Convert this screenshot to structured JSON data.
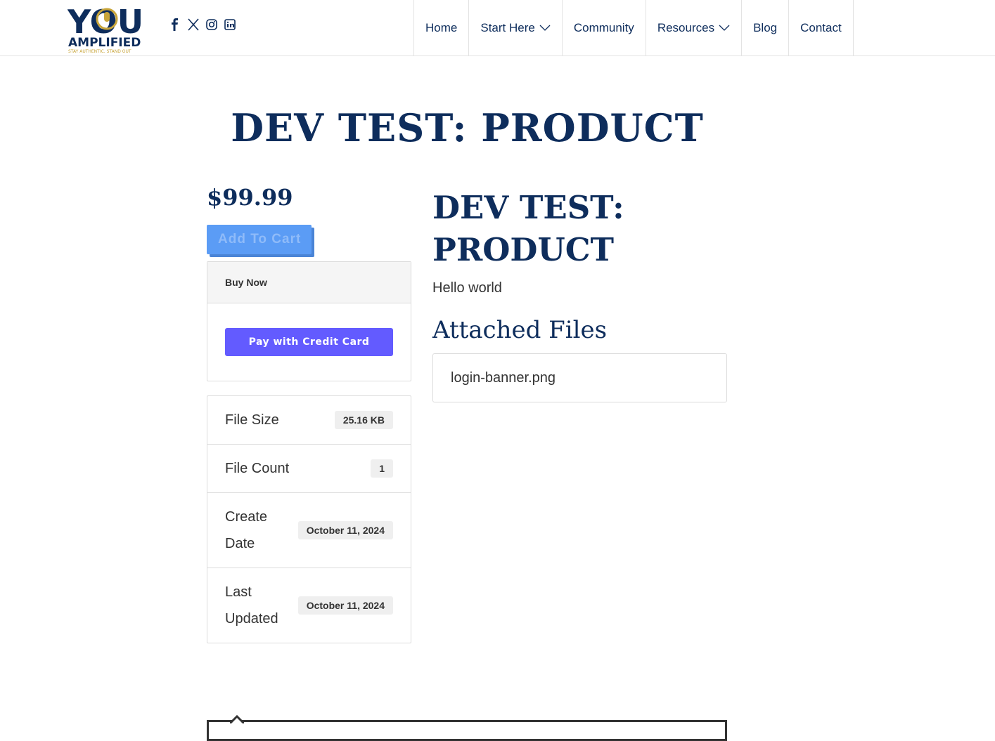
{
  "brand": {
    "logo_line1": "YOU",
    "logo_line2": "AMPLIFIED",
    "tagline": "STAY AUTHENTIC. STAND OUT",
    "colors": {
      "navy": "#0e2d5c",
      "gold": "#c8a53a",
      "stripe": "#635bff",
      "cart": "#5b9cf5"
    }
  },
  "social": [
    "facebook-icon",
    "x-icon",
    "instagram-icon",
    "linkedin-icon"
  ],
  "nav": {
    "home": "Home",
    "start_here": "Start Here",
    "community": "Community",
    "resources": "Resources",
    "blog": "Blog",
    "contact": "Contact"
  },
  "page_title": "DEV TEST: PRODUCT",
  "product": {
    "price": "$99.99",
    "add_to_cart": "Add To Cart",
    "buy_now": "Buy Now",
    "pay_button": "Pay with Credit Card",
    "title": "DEV TEST: PRODUCT",
    "description": "Hello world",
    "attached_files_title": "Attached Files",
    "files": [
      "login-banner.png"
    ]
  },
  "meta": {
    "file_size_label": "File Size",
    "file_size_value": "25.16 KB",
    "file_count_label": "File Count",
    "file_count_value": "1",
    "create_date_label": "Create Date",
    "create_date_value": "October 11, 2024",
    "last_updated_label": "Last Updated",
    "last_updated_value": "October 11, 2024"
  }
}
